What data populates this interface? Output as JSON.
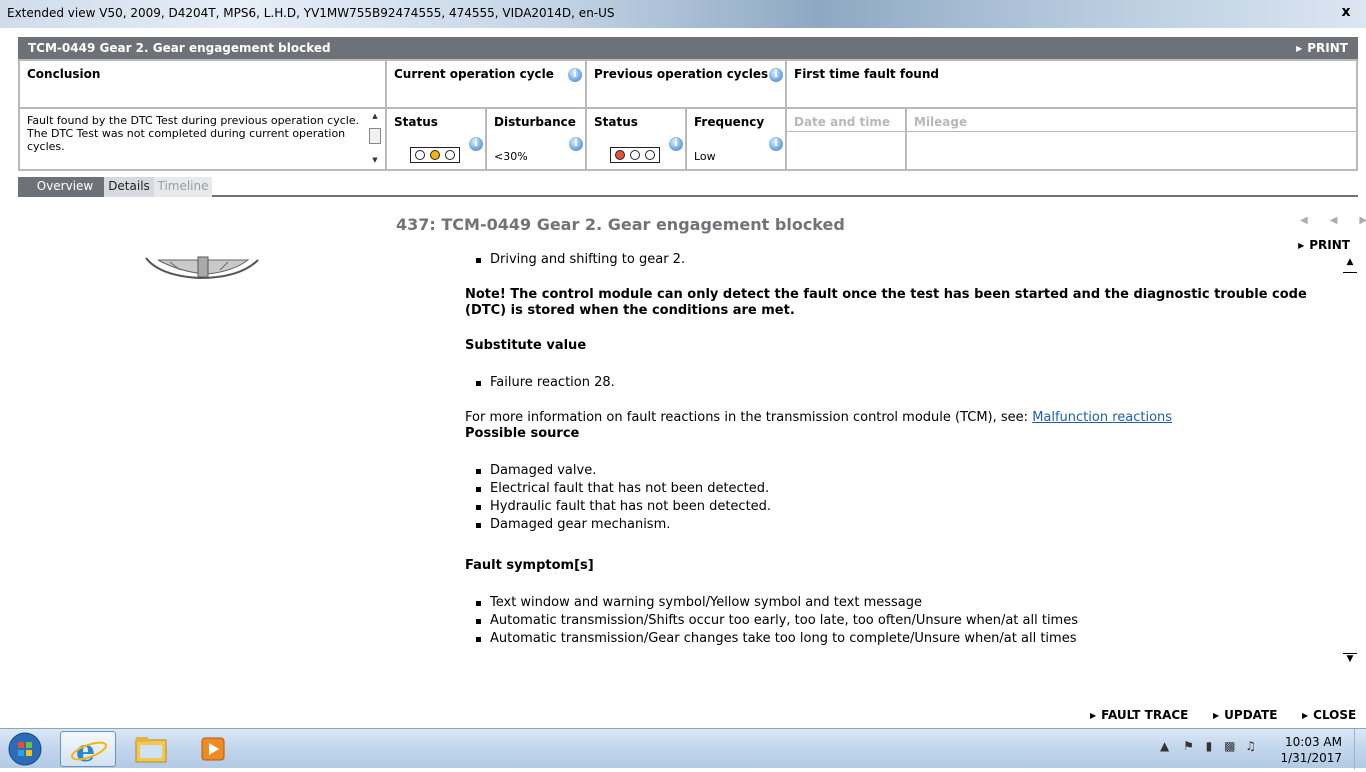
{
  "window": {
    "title": "Extended view   V50, 2009, D4204T, MPS6, L.H.D, YV1MW755B92474555, 474555, VIDA2014D, en-US",
    "close_label": "x"
  },
  "header": {
    "title": "TCM-0449 Gear 2. Gear engagement blocked",
    "print_label": "PRINT"
  },
  "summary": {
    "conclusion_label": "Conclusion",
    "conclusion_text": "Fault found by the DTC Test during previous operation cycle.\nThe DTC Test was not completed during current operation cycles.",
    "current_cycle_label": "Current operation cycle",
    "previous_cycles_label": "Previous operation cycles",
    "first_time_label": "First time fault found",
    "status_label": "Status",
    "disturbance_label": "Disturbance",
    "status2_label": "Status",
    "frequency_label": "Frequency",
    "date_time_label": "Date and time",
    "mileage_label": "Mileage",
    "disturbance_value": "<30%",
    "frequency_value": "Low",
    "current_status_lamps": [
      "off",
      "yellow",
      "off"
    ],
    "previous_status_lamps": [
      "red",
      "off",
      "off"
    ],
    "info_icon": "i"
  },
  "tabs": [
    "Overview",
    "Details",
    "Timeline"
  ],
  "detail": {
    "title": "437: TCM-0449 Gear 2. Gear engagement blocked",
    "print_label": "PRINT",
    "nav_arrows": "◀◀ ▶▶",
    "bullet_top": "Driving and shifting to gear 2.",
    "note": "Note! The control module can only detect the fault once the test has been started and the diagnostic trouble code (DTC) is stored when the conditions are met.",
    "substitute_heading": "Substitute value",
    "substitute_items": [
      "Failure reaction 28."
    ],
    "more_info_text": "For more information on fault reactions in the transmission control module (TCM), see: ",
    "more_info_link": "Malfunction reactions",
    "possible_source_heading": "Possible source",
    "possible_source_items": [
      "Damaged valve.",
      "Electrical fault that has not been detected.",
      "Hydraulic fault that has not been detected.",
      "Damaged gear mechanism."
    ],
    "fault_symptom_heading": "Fault symptom[s]",
    "fault_symptom_items": [
      "Text window and warning symbol/Yellow symbol and text message",
      "Automatic transmission/Shifts occur too early, too late, too often/Unsure when/at all times",
      "Automatic transmission/Gear changes take too long to complete/Unsure when/at all times"
    ]
  },
  "actions": {
    "fault_trace": "FAULT TRACE",
    "update": "UPDATE",
    "close": "CLOSE"
  },
  "taskbar": {
    "time": "10:03 AM",
    "date": "1/31/2017"
  },
  "colors": {
    "header_bg": "#6d7178",
    "link": "#1f5fb0",
    "lamp_yellow": "#f2b705",
    "lamp_red": "#e8503a"
  }
}
